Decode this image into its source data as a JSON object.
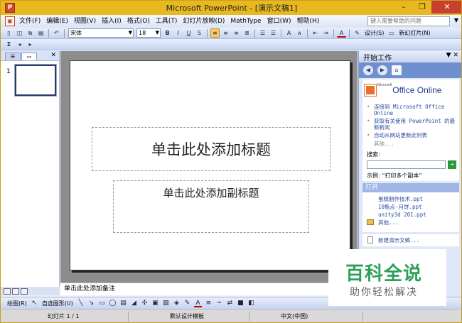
{
  "window": {
    "title": "Microsoft PowerPoint - [演示文稿1]",
    "app_icon": "P",
    "minimize": "–",
    "restore": "❐",
    "close": "✕"
  },
  "menu": {
    "items": [
      "文件(F)",
      "编辑(E)",
      "视图(V)",
      "插入(I)",
      "格式(O)",
      "工具(T)",
      "幻灯片放映(D)",
      "MathType",
      "窗口(W)",
      "帮助(H)"
    ],
    "help_placeholder": "键入需要帮助的问题"
  },
  "toolbar": {
    "font_name": "宋体",
    "font_size": "18",
    "bold": "B",
    "italic": "I",
    "underline": "U",
    "shadow": "S",
    "design_label": "设计(S)",
    "new_slide_label": "新幻灯片(N)"
  },
  "left_pane": {
    "slide_number": "1",
    "close": "✕"
  },
  "slide": {
    "title_placeholder": "单击此处添加标题",
    "subtitle_placeholder": "单击此处添加副标题"
  },
  "notes": {
    "placeholder": "单击此处添加备注"
  },
  "drawbar": {
    "draw_label": "绘图(R)",
    "autoshapes_label": "自选图形(U)"
  },
  "status": {
    "slide_info": "幻灯片 1 / 1",
    "design": "默认设计模板",
    "language": "中文(中国)"
  },
  "taskpane": {
    "title": "开始工作",
    "office_online": "Office Online",
    "microsoft_small": "Microsoft",
    "links": [
      "连接到 Microsoft Office Online",
      "获取有关使用 PowerPoint 的最新新闻",
      "自动从网站更新此列表"
    ],
    "more": "其他...",
    "search_label": "搜索:",
    "search_go": "➔",
    "example": "示例: “打印多个副本”",
    "open_header": "打开",
    "files": [
      "蛋糕制作技术.ppt",
      "10瓶点-月饼.ppt",
      "unity3d 201.ppt"
    ],
    "open_more": "其他...",
    "new_presentation": "新建演示文稿..."
  },
  "watermark": {
    "title": "百科全说",
    "subtitle": "助你轻松解决"
  }
}
